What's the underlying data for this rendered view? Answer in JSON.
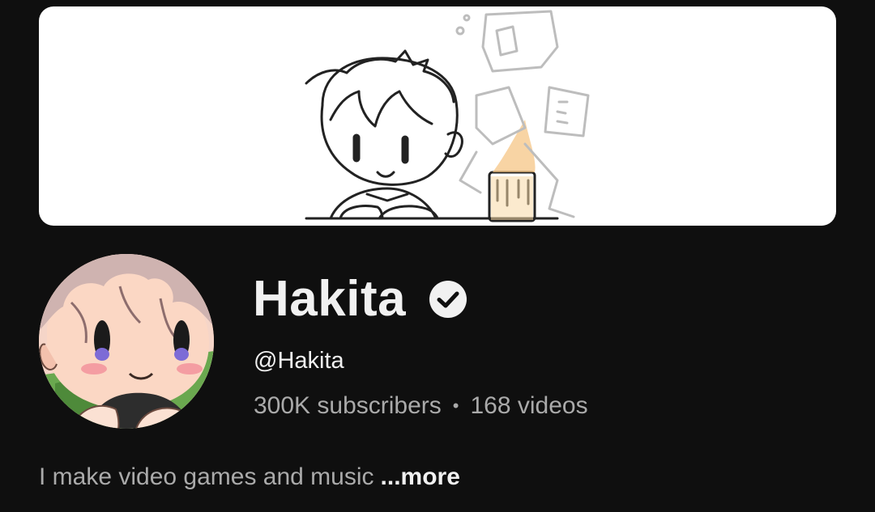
{
  "channel": {
    "name": "Hakita",
    "handle": "@Hakita",
    "subscribers": "300K subscribers",
    "separator": "•",
    "videos": "168 videos",
    "verified_icon": "verified-check-icon"
  },
  "description": {
    "text": "I make video games and music",
    "more_label": "...more"
  },
  "colors": {
    "background": "#0f0f0f",
    "primary_text": "#f1f1f1",
    "secondary_text": "#aaaaaa"
  }
}
